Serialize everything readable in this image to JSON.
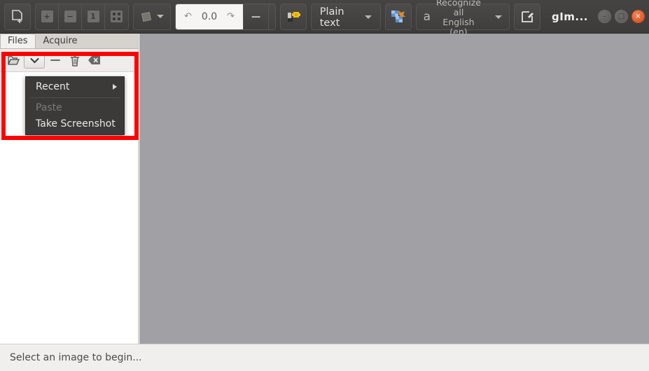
{
  "window": {
    "title": "gIm...",
    "controls": [
      {
        "name": "minimize",
        "glyph": "–"
      },
      {
        "name": "maximize",
        "glyph": "□"
      },
      {
        "name": "close",
        "glyph": "×"
      }
    ]
  },
  "header": {
    "add_page_icon": "add-page-icon",
    "zoom_in_label": "+",
    "zoom_out_label": "−",
    "zoom_one_label": "1",
    "zoom_fit_label": "⬚",
    "rotate_icon": "rotate-icon",
    "rotate_dropdown_icon": "chevron-down-icon",
    "rotate_left_icon": "↶",
    "rotate_value": "0.0",
    "rotate_right_icon": "↷",
    "brightness_minus": "−",
    "brightness_plus": "+",
    "unpaper_icon": "unpaper-icon",
    "output_mode": "Plain text",
    "output_mode_caret": "chevron-down-icon",
    "spell_icon": "magic-wand-icon",
    "recognize_glyph": "a",
    "recognize_line1": "Recognize all",
    "recognize_line2": "English (en)",
    "recognize_caret": "chevron-down-icon",
    "editor_icon": "edit-document-icon"
  },
  "left_panel": {
    "tabs": [
      {
        "label": "Files",
        "active": true
      },
      {
        "label": "Acquire",
        "active": false
      }
    ],
    "toolbar": [
      {
        "name": "add-images-button",
        "icon": "folder-open-icon"
      },
      {
        "name": "add-images-dropdown-button",
        "icon": "chevron-down-icon"
      },
      {
        "name": "remove-image-button",
        "icon": "minus-icon"
      },
      {
        "name": "delete-image-button",
        "icon": "trash-icon"
      },
      {
        "name": "clear-list-button",
        "icon": "clear-icon"
      }
    ]
  },
  "menu": {
    "items": [
      {
        "label": "Recent",
        "disabled": false,
        "submenu": true
      },
      {
        "label": "Paste",
        "disabled": true,
        "submenu": false
      },
      {
        "label": "Take Screenshot",
        "disabled": false,
        "submenu": false
      }
    ]
  },
  "statusbar": {
    "message": "Select an image to begin..."
  },
  "colors": {
    "header_bg": "#3f3e3c",
    "canvas_bg": "#a1a0a5",
    "annotation_red": "#fe0000",
    "close_orange": "#da4a17"
  }
}
